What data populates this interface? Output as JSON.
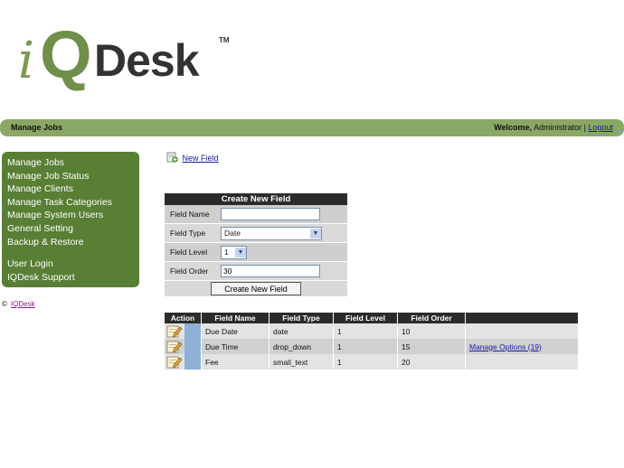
{
  "logo": {
    "i": "i",
    "q": "Q",
    "desk": "Desk",
    "tm": "TM"
  },
  "header": {
    "title": "Manage Jobs",
    "welcome_bold": "Welcome,",
    "user": "Administrator",
    "separator": "|",
    "logout": "Logout"
  },
  "sidebar": {
    "items": [
      "Manage Jobs",
      "Manage Job Status",
      "Manage Clients",
      "Manage Task Categories",
      "Manage System Users",
      "General Setting",
      "Backup & Restore",
      "User Login",
      "IQDesk Support"
    ]
  },
  "footer": {
    "copyright_symbol": "©",
    "brand_link": "IQDesk"
  },
  "new_field_link": "New Field",
  "create_form": {
    "title": "Create New Field",
    "field_name_label": "Field Name",
    "field_name_value": "",
    "field_type_label": "Field Type",
    "field_type_value": "Date",
    "field_level_label": "Field Level",
    "field_level_value": "1",
    "field_order_label": "Field Order",
    "field_order_value": "30",
    "submit": "Create New Field"
  },
  "fields_table": {
    "headers": [
      "Action",
      "Field Name",
      "Field Type",
      "Field Level",
      "Field Order",
      ""
    ],
    "rows": [
      {
        "name": "Due Date",
        "type": "date",
        "level": "1",
        "order": "10",
        "extra": ""
      },
      {
        "name": "Due Time",
        "type": "drop_down",
        "level": "1",
        "order": "15",
        "extra": "Manage Options (19)"
      },
      {
        "name": "Fee",
        "type": "small_text",
        "level": "1",
        "order": "20",
        "extra": ""
      }
    ]
  },
  "colors": {
    "brand_green": "#587f34",
    "header_bar": "#8aa766",
    "table_header": "#2b2b2b",
    "link": "#1a1aa6"
  }
}
